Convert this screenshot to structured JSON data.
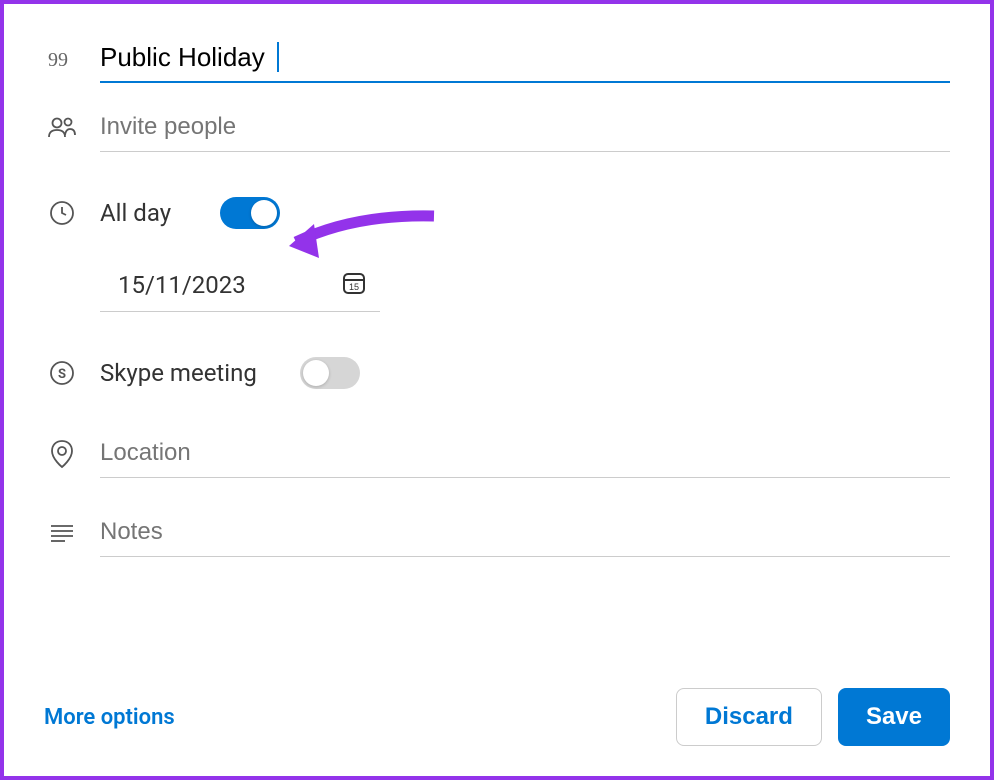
{
  "title": {
    "value": "Public Holiday"
  },
  "invite": {
    "placeholder": "Invite people"
  },
  "allDay": {
    "label": "All day",
    "on": true
  },
  "date": {
    "value": "15/11/2023",
    "iconDay": "15"
  },
  "skype": {
    "label": "Skype meeting",
    "on": false
  },
  "location": {
    "placeholder": "Location"
  },
  "notes": {
    "placeholder": "Notes"
  },
  "footer": {
    "moreOptions": "More options",
    "discard": "Discard",
    "save": "Save"
  },
  "colors": {
    "primary": "#0078d4",
    "arrow": "#9333ea"
  }
}
